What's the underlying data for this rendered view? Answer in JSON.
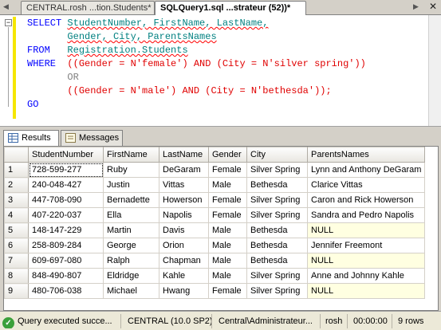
{
  "doc_tabs": [
    {
      "label": "CENTRAL.rosh ...tion.Students*",
      "active": false
    },
    {
      "label": "SQLQuery1.sql ...strateur (52))*",
      "active": true
    }
  ],
  "editor": {
    "lines": [
      {
        "kw1": "SELECT",
        "rest": "StudentNumber, FirstName, LastName,"
      },
      {
        "rest": "Gender, City, ParentsNames"
      },
      {
        "kw1": "FROM",
        "rest": "Registration.Students"
      },
      {
        "kw1": "WHERE",
        "rest": "((Gender = N'female') AND (City = N'silver spring'))"
      },
      {
        "rest": "OR"
      },
      {
        "rest": "((Gender = N'male') AND (City = N'bethesda'));"
      },
      {
        "kw1": "GO"
      }
    ]
  },
  "results_tabs": [
    {
      "label": "Results",
      "icon": "grid-icon",
      "active": true
    },
    {
      "label": "Messages",
      "icon": "messages-icon",
      "active": false
    }
  ],
  "grid": {
    "columns": [
      "StudentNumber",
      "FirstName",
      "LastName",
      "Gender",
      "City",
      "ParentsNames"
    ],
    "rows": [
      {
        "n": "1",
        "cells": [
          "728-599-277",
          "Ruby",
          "DeGaram",
          "Female",
          "Silver Spring",
          "Lynn and Anthony DeGaram"
        ]
      },
      {
        "n": "2",
        "cells": [
          "240-048-427",
          "Justin",
          "Vittas",
          "Male",
          "Bethesda",
          "Clarice Vittas"
        ]
      },
      {
        "n": "3",
        "cells": [
          "447-708-090",
          "Bernadette",
          "Howerson",
          "Female",
          "Silver Spring",
          "Caron and Rick Howerson"
        ]
      },
      {
        "n": "4",
        "cells": [
          "407-220-037",
          "Ella",
          "Napolis",
          "Female",
          "Silver Spring",
          "Sandra and Pedro Napolis"
        ]
      },
      {
        "n": "5",
        "cells": [
          "148-147-229",
          "Martin",
          "Davis",
          "Male",
          "Bethesda",
          "NULL"
        ]
      },
      {
        "n": "6",
        "cells": [
          "258-809-284",
          "George",
          "Orion",
          "Male",
          "Bethesda",
          "Jennifer Freemont"
        ]
      },
      {
        "n": "7",
        "cells": [
          "609-697-080",
          "Ralph",
          "Chapman",
          "Male",
          "Bethesda",
          "NULL"
        ]
      },
      {
        "n": "8",
        "cells": [
          "848-490-807",
          "Eldridge",
          "Kahle",
          "Male",
          "Silver Spring",
          "Anne and Johnny Kahle"
        ]
      },
      {
        "n": "9",
        "cells": [
          "480-706-038",
          "Michael",
          "Hwang",
          "Female",
          "Silver Spring",
          "NULL"
        ]
      }
    ]
  },
  "status": {
    "message": "Query executed succe...",
    "server": "CENTRAL (10.0 SP2)",
    "user": "Central\\Administrateur...",
    "database": "rosh",
    "elapsed": "00:00:00",
    "rows": "9 rows"
  },
  "colors": {
    "keyword": "#0000ff",
    "string": "#e00000",
    "identifier": "#008080",
    "null_cell": "#ffffe1"
  }
}
